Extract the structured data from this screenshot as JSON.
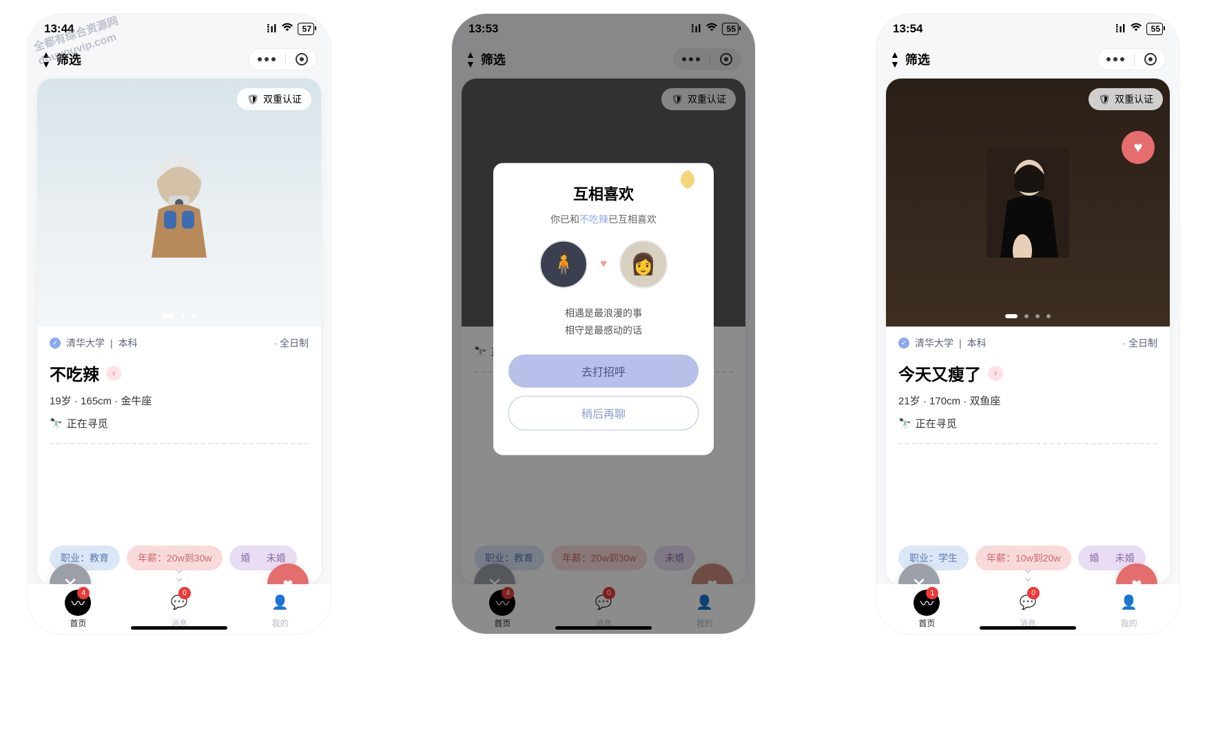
{
  "watermark": {
    "line1": "全都有综合资源网",
    "line2": "douyouvip.com"
  },
  "header": {
    "filter": "筛选"
  },
  "verify_label": "双重认证",
  "screens": [
    {
      "time": "13:44",
      "battery": "57",
      "edu": {
        "school": "清华大学",
        "degree": "本科",
        "mode": "· 全日制"
      },
      "name": "不吃辣",
      "stats": "19岁 · 165cm · 金牛座",
      "seeking": "正在寻觅",
      "tags": {
        "job": "职业：教育",
        "salary": "年薪：20w到30w",
        "marital_prefix": "婚",
        "marital_suffix": "未婚"
      },
      "tabs": {
        "home_badge": "4",
        "msg_badge": "0"
      }
    },
    {
      "time": "13:53",
      "battery": "55",
      "seeking": "正在寻觅",
      "tags": {
        "job": "职业：教育",
        "salary": "年薪：20w到30w",
        "marital_suffix": "未婚"
      },
      "tabs": {
        "home_badge": "4",
        "msg_badge": "0"
      },
      "modal": {
        "title": "互相喜欢",
        "sub_pre": "你已和",
        "sub_name": "不吃辣",
        "sub_post": "已互相喜欢",
        "line1": "相遇是最浪漫的事",
        "line2": "相守是最感动的话",
        "btn_primary": "去打招呼",
        "btn_ghost": "稍后再聊"
      }
    },
    {
      "time": "13:54",
      "battery": "55",
      "edu": {
        "school": "清华大学",
        "degree": "本科",
        "mode": "· 全日制"
      },
      "name": "今天又瘦了",
      "stats": "21岁 · 170cm · 双鱼座",
      "seeking": "正在寻觅",
      "tags": {
        "job": "职业：学生",
        "salary": "年薪：10w到20w",
        "marital_prefix": "婚",
        "marital_suffix": "未婚"
      },
      "tabs": {
        "home_badge": "1",
        "msg_badge": "0"
      }
    }
  ],
  "tab_labels": {
    "home": "首页",
    "msg": "消息",
    "me": "我的"
  }
}
